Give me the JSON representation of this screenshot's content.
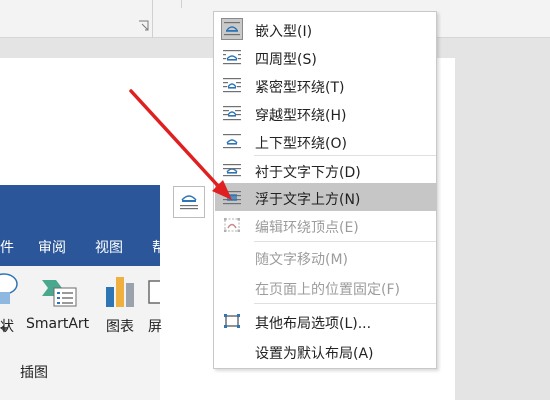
{
  "embedded_ribbon": {
    "tabs": [
      "件",
      "审阅",
      "视图",
      "帮"
    ],
    "buttons": [
      "状",
      "SmartArt",
      "图表",
      "屏"
    ],
    "group_label": "插图"
  },
  "context_menu": {
    "items": [
      {
        "label": "嵌入型(I)",
        "icon": "inline-text-wrap-icon",
        "state": "checked"
      },
      {
        "label": "四周型(S)",
        "icon": "square-wrap-icon",
        "state": "normal"
      },
      {
        "label": "紧密型环绕(T)",
        "icon": "tight-wrap-icon",
        "state": "normal"
      },
      {
        "label": "穿越型环绕(H)",
        "icon": "through-wrap-icon",
        "state": "normal"
      },
      {
        "label": "上下型环绕(O)",
        "icon": "top-bottom-wrap-icon",
        "state": "normal"
      },
      {
        "label": "衬于文字下方(D)",
        "icon": "behind-text-icon",
        "state": "normal"
      },
      {
        "label": "浮于文字上方(N)",
        "icon": "in-front-of-text-icon",
        "state": "hovered"
      },
      {
        "label": "编辑环绕顶点(E)",
        "icon": "edit-wrap-points-icon",
        "state": "disabled"
      },
      {
        "label": "随文字移动(M)",
        "icon": "",
        "state": "disabled"
      },
      {
        "label": "在页面上的位置固定(F)",
        "icon": "",
        "state": "disabled"
      },
      {
        "label": "其他布局选项(L)...",
        "icon": "more-layout-options-icon",
        "state": "normal"
      },
      {
        "label": "设置为默认布局(A)",
        "icon": "",
        "state": "normal"
      }
    ]
  },
  "colors": {
    "ribbon_blue": "#2b579a",
    "menu_hover": "#c6c6c6",
    "arrow_red": "#e02020",
    "icon_blue": "#2e75b6",
    "icon_gray": "#9aa3ad"
  }
}
